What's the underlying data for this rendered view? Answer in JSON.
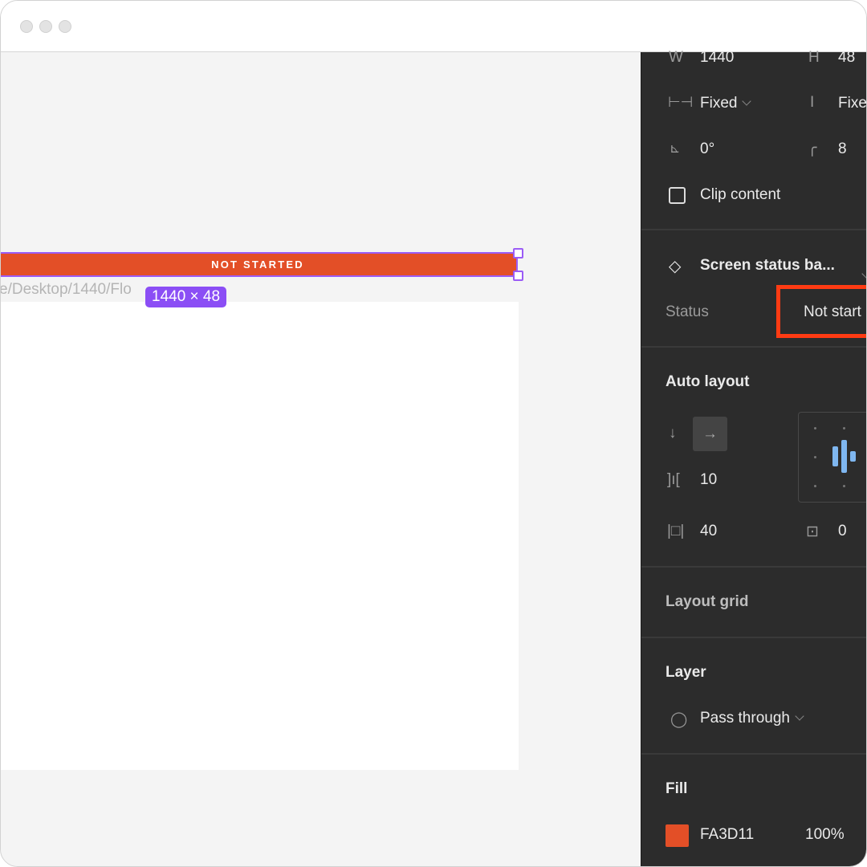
{
  "window": {
    "controls": [
      "close",
      "minimize",
      "maximize"
    ]
  },
  "canvas": {
    "status_bar_text": "NOT STARTED",
    "frame_path": "e/Desktop/1440/Flo",
    "size_badge": "1440 × 48",
    "status_color": "#E34F27",
    "selection_color": "#8B4EF5"
  },
  "panel": {
    "w_label": "W",
    "w_value": "1440",
    "h_label": "H",
    "h_value": "48",
    "width_mode": "Fixed",
    "height_mode": "Fixe",
    "rotation": "0°",
    "corner_radius": "8",
    "clip_content": "Clip content",
    "component_name": "Screen status ba...",
    "status_label": "Status",
    "status_value": "Not start",
    "auto_layout_title": "Auto layout",
    "gap": "10",
    "padding_horizontal": "40",
    "padding_vertical": "0",
    "layout_grid_title": "Layout grid",
    "layer_title": "Layer",
    "blend_mode": "Pass through",
    "fill_title": "Fill",
    "fill_hex": "FA3D11",
    "fill_opacity": "100%",
    "highlight_color": "#FF3B13"
  }
}
